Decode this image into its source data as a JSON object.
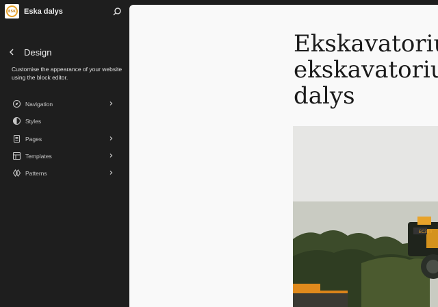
{
  "site": {
    "title": "Eska dalys",
    "logo_text": "ESK"
  },
  "panel": {
    "title": "Design",
    "description": "Customise the appearance of your website using the block editor."
  },
  "nav": [
    {
      "label": "Navigation",
      "icon": "navigation-icon",
      "has_chevron": true
    },
    {
      "label": "Styles",
      "icon": "styles-icon",
      "has_chevron": false
    },
    {
      "label": "Pages",
      "icon": "pages-icon",
      "has_chevron": true
    },
    {
      "label": "Templates",
      "icon": "templates-icon",
      "has_chevron": true
    },
    {
      "label": "Patterns",
      "icon": "patterns-icon",
      "has_chevron": true
    }
  ],
  "canvas": {
    "page_title": "Ekskavatorių / r\nekskavatorių / b\ndalys",
    "hero_badge": "EC380"
  },
  "colors": {
    "sidebar_bg": "#1e1e1e",
    "canvas_bg": "#f9f9f9",
    "accent": "#e8a32a"
  }
}
